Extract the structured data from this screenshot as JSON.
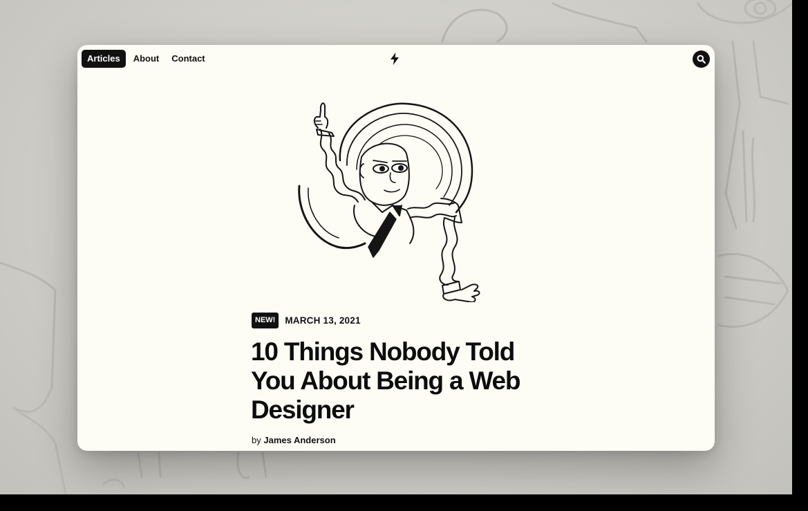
{
  "nav": {
    "items": [
      {
        "label": "Articles",
        "active": true
      },
      {
        "label": "About",
        "active": false
      },
      {
        "label": "Contact",
        "active": false
      }
    ]
  },
  "header": {
    "logo_icon": "lightning-bolt-icon",
    "search_icon": "search-icon"
  },
  "article": {
    "badge": "NEW!",
    "date": "MARCH 13, 2021",
    "title": "10 Things Nobody Told You About Being a Web Designer",
    "byline_prefix": "by",
    "author": "James Anderson"
  },
  "colors": {
    "page_background": "#fdfcf5",
    "ink": "#111111",
    "backdrop": "#d3d2cc"
  }
}
